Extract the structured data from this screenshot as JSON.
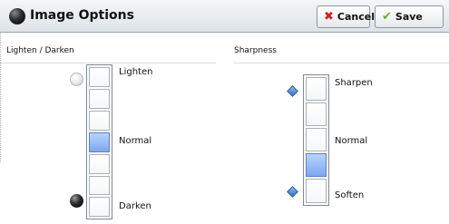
{
  "header": {
    "title": "Image Options",
    "cancel_label": "Cancel",
    "save_label": "Save"
  },
  "lighten_darken": {
    "title": "Lighten / Darken",
    "top_label": "Lighten",
    "middle_label": "Normal",
    "bottom_label": "Darken",
    "levels": 7,
    "selected_level": "Normal"
  },
  "sharpness": {
    "title": "Sharpness",
    "top_label": "Sharpen",
    "middle_label": "Normal",
    "bottom_label": "Soften",
    "levels": 5,
    "selected_level": 4
  },
  "colors": {
    "selected_cell": "#7ea7f0",
    "header_background": "#dfe3e8",
    "cancel_icon": "#d21f1f",
    "save_icon": "#6cae2e"
  },
  "icons": {
    "header": "dark-circle-icon",
    "cancel": "x-icon",
    "save": "checkmark-icon",
    "lighten_marker": "light-circle-icon",
    "darken_marker": "dark-circle-icon",
    "sharpness_markers": "diamond-icon"
  }
}
